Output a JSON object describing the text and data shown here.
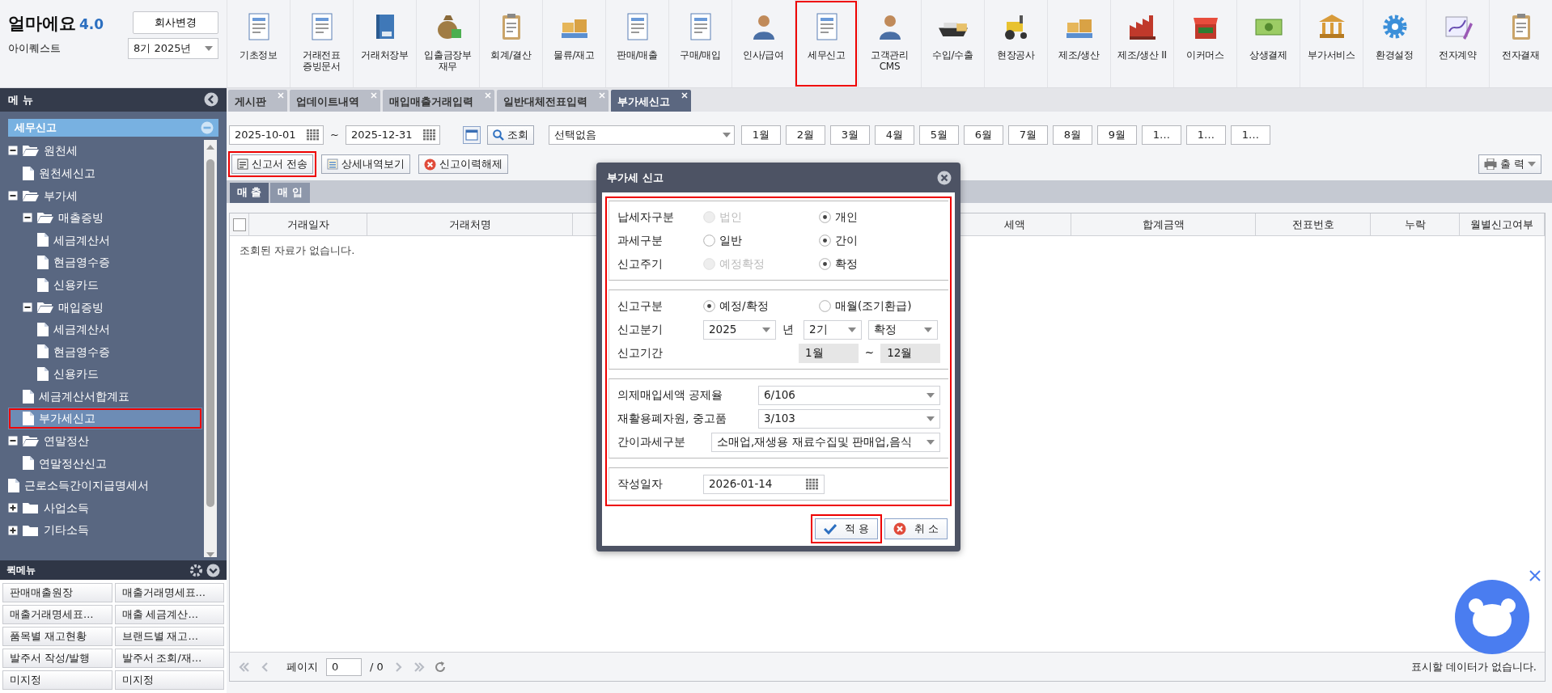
{
  "app": {
    "name": "얼마에요",
    "version": "4.0",
    "company": "아이퀘스트",
    "change_company_button": "회사변경",
    "period_select": "8기 2025년"
  },
  "toolbar": [
    {
      "label": "기초정보",
      "highlighted": false
    },
    {
      "label": "거래전표\n증빙문서",
      "highlighted": false
    },
    {
      "label": "거래처장부",
      "highlighted": false
    },
    {
      "label": "입출금장부\n재무",
      "highlighted": false
    },
    {
      "label": "회계/결산",
      "highlighted": false
    },
    {
      "label": "물류/재고",
      "highlighted": false
    },
    {
      "label": "판매/매출",
      "highlighted": false
    },
    {
      "label": "구매/매입",
      "highlighted": false
    },
    {
      "label": "인사/급여",
      "highlighted": false
    },
    {
      "label": "세무신고",
      "highlighted": true
    },
    {
      "label": "고객관리\nCMS",
      "highlighted": false
    },
    {
      "label": "수입/수출",
      "highlighted": false
    },
    {
      "label": "현장공사",
      "highlighted": false
    },
    {
      "label": "제조/생산",
      "highlighted": false
    },
    {
      "label": "제조/생산 II",
      "highlighted": false
    },
    {
      "label": "이커머스",
      "highlighted": false
    },
    {
      "label": "상생결제",
      "highlighted": false
    },
    {
      "label": "부가서비스",
      "highlighted": false
    },
    {
      "label": "환경설정",
      "highlighted": false
    },
    {
      "label": "전자계약",
      "highlighted": false
    },
    {
      "label": "전자결재",
      "highlighted": false
    }
  ],
  "tabs": [
    {
      "label": "게시판",
      "selected": false
    },
    {
      "label": "업데이트내역",
      "selected": false
    },
    {
      "label": "매입매출거래입력",
      "selected": false
    },
    {
      "label": "일반대체전표입력",
      "selected": false
    },
    {
      "label": "부가세신고",
      "selected": true
    }
  ],
  "sidebar": {
    "title": "메 뉴",
    "section": "세무신고",
    "tree": [
      {
        "label": "원천세",
        "kind": "folder",
        "expanded": true,
        "selected": false,
        "highlighted": false,
        "children": [
          {
            "label": "원천세신고",
            "kind": "file",
            "selected": false,
            "highlighted": false
          }
        ]
      },
      {
        "label": "부가세",
        "kind": "folder",
        "expanded": true,
        "selected": false,
        "highlighted": false,
        "children": [
          {
            "label": "매출증빙",
            "kind": "folder",
            "expanded": true,
            "selected": false,
            "highlighted": false,
            "children": [
              {
                "label": "세금계산서",
                "kind": "file",
                "selected": false,
                "highlighted": false
              },
              {
                "label": "현금영수증",
                "kind": "file",
                "selected": false,
                "highlighted": false
              },
              {
                "label": "신용카드",
                "kind": "file",
                "selected": false,
                "highlighted": false
              }
            ]
          },
          {
            "label": "매입증빙",
            "kind": "folder",
            "expanded": true,
            "selected": false,
            "highlighted": false,
            "children": [
              {
                "label": "세금계산서",
                "kind": "file",
                "selected": false,
                "highlighted": false
              },
              {
                "label": "현금영수증",
                "kind": "file",
                "selected": false,
                "highlighted": false
              },
              {
                "label": "신용카드",
                "kind": "file",
                "selected": false,
                "highlighted": false
              }
            ]
          },
          {
            "label": "세금계산서합계표",
            "kind": "file",
            "selected": false,
            "highlighted": false
          },
          {
            "label": "부가세신고",
            "kind": "file",
            "selected": true,
            "highlighted": true
          }
        ]
      },
      {
        "label": "연말정산",
        "kind": "folder",
        "expanded": true,
        "selected": false,
        "highlighted": false,
        "children": [
          {
            "label": "연말정산신고",
            "kind": "file",
            "selected": false,
            "highlighted": false
          }
        ]
      },
      {
        "label": "근로소득간이지급명세서",
        "kind": "file",
        "selected": false,
        "highlighted": false
      },
      {
        "label": "사업소득",
        "kind": "folder",
        "expanded": false,
        "selected": false,
        "highlighted": false
      },
      {
        "label": "기타소득",
        "kind": "folder",
        "expanded": false,
        "selected": false,
        "highlighted": false
      }
    ]
  },
  "quick_menu": {
    "title": "퀵메뉴",
    "items": [
      "판매매출원장",
      "매출거래명세표…",
      "매출거래명세표…",
      "매출 세금계산…",
      "품목별 재고현황",
      "브랜드별 재고…",
      "발주서 작성/발행",
      "발주서 조회/재…",
      "미지정",
      "미지정"
    ]
  },
  "filter": {
    "date_from": "2025-10-01",
    "separator": "~",
    "date_to": "2025-12-31",
    "search_button": "조회",
    "select": "선택없음",
    "months": [
      "1월",
      "2월",
      "3월",
      "4월",
      "5월",
      "6월",
      "7월",
      "8월",
      "9월",
      "1…",
      "1…",
      "1…"
    ]
  },
  "actions": [
    {
      "label": "신고서 전송",
      "kind": "send",
      "highlighted": true
    },
    {
      "label": "상세내역보기",
      "kind": "detail",
      "highlighted": false
    },
    {
      "label": "신고이력해제",
      "kind": "release",
      "highlighted": false
    }
  ],
  "print_button": "출 력",
  "sub_tabs": [
    {
      "label": "매 출",
      "selected": true
    },
    {
      "label": "매 입",
      "selected": false
    }
  ],
  "table": {
    "select_all_checked": false,
    "columns": [
      "거래일자",
      "거래처명",
      "세액",
      "합계금액",
      "전표번호",
      "누락",
      "월별신고여부"
    ],
    "empty_message": "조회된 자료가 없습니다."
  },
  "pager": {
    "label": "페이지",
    "page": "0",
    "total": "/ 0",
    "status": "표시할 데이터가 없습니다."
  },
  "dialog": {
    "title": "부가세 신고",
    "highlighted": true,
    "sections": [
      {
        "rows": [
          {
            "kind": "radio",
            "label": "납세자구분",
            "options": [
              {
                "label": "법인",
                "selected": false,
                "disabled": true
              },
              {
                "label": "개인",
                "selected": true,
                "disabled": false
              }
            ]
          },
          {
            "kind": "radio",
            "label": "과세구분",
            "options": [
              {
                "label": "일반",
                "selected": false,
                "disabled": false
              },
              {
                "label": "간이",
                "selected": true,
                "disabled": false
              }
            ]
          },
          {
            "kind": "radio",
            "label": "신고주기",
            "options": [
              {
                "label": "예정확정",
                "selected": false,
                "disabled": true
              },
              {
                "label": "확정",
                "selected": true,
                "disabled": false
              }
            ]
          }
        ]
      },
      {
        "rows": [
          {
            "kind": "radio",
            "label": "신고구분",
            "options": [
              {
                "label": "예정/확정",
                "selected": true,
                "disabled": false
              },
              {
                "label": "매월(조기환급)",
                "selected": false,
                "disabled": false
              }
            ]
          },
          {
            "kind": "period",
            "label": "신고분기",
            "year": "2025",
            "year_unit": "년",
            "half": "2기",
            "type": "확정"
          },
          {
            "kind": "range",
            "label": "신고기간",
            "from": "1월",
            "separator": "~",
            "to": "12월"
          }
        ]
      },
      {
        "rows": [
          {
            "kind": "dropdown",
            "label": "의제매입세액 공제율",
            "value": "6/106"
          },
          {
            "kind": "dropdown",
            "label": "재활용폐자원, 중고품",
            "value": "3/103"
          },
          {
            "kind": "wide_dropdown",
            "label": "간이과세구분",
            "value": "소매업,재생용 재료수집및 판매업,음식"
          }
        ]
      },
      {
        "rows": [
          {
            "kind": "date",
            "label": "작성일자",
            "value": "2026-01-14"
          }
        ]
      }
    ],
    "buttons": [
      {
        "label": "적 용",
        "kind": "apply",
        "highlighted": true
      },
      {
        "label": "취 소",
        "kind": "cancel",
        "highlighted": false
      }
    ]
  }
}
